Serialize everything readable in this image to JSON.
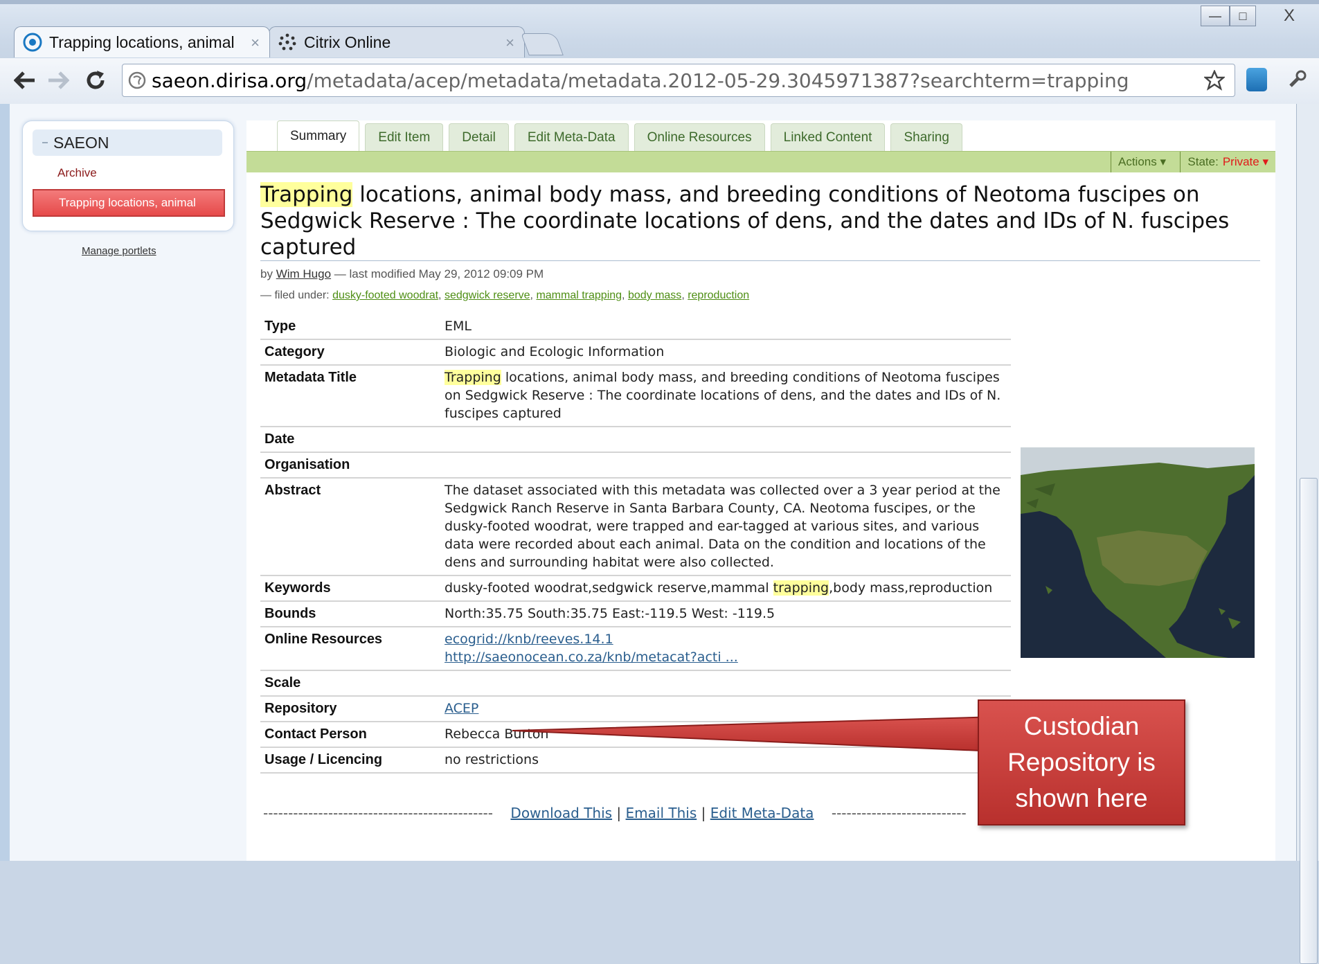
{
  "browser": {
    "tabs": [
      {
        "label": "Trapping locations, animal",
        "active": true,
        "icon": "globe-icon"
      },
      {
        "label": "Citrix Online",
        "active": false,
        "icon": "citrix-icon"
      }
    ],
    "address": {
      "host": "saeon.dirisa.org",
      "path": "/metadata/acep/metadata/metadata.2012-05-29.3045971387?searchterm=trapping"
    },
    "window_buttons": {
      "minimize": "—",
      "maximize": "□",
      "close": "X"
    }
  },
  "portlet": {
    "header": "SAEON",
    "archive_link": "Archive",
    "selected_item": "Trapping locations, animal",
    "manage_link": "Manage portlets"
  },
  "content_tabs": [
    "Summary",
    "Edit Item",
    "Detail",
    "Edit Meta-Data",
    "Online Resources",
    "Linked Content",
    "Sharing"
  ],
  "action_bar": {
    "actions": "Actions ▾",
    "state_label": "State:",
    "state_value": "Private ▾"
  },
  "title": {
    "highlight": "Trapping",
    "rest": " locations, animal body mass, and breeding conditions of Neotoma fuscipes on Sedgwick Reserve : The coordinate locations of dens, and the dates and IDs of N. fuscipes captured"
  },
  "byline": {
    "prefix": "by",
    "author": "Wim Hugo",
    "modified": "— last modified May 29, 2012 09:09 PM"
  },
  "filed": {
    "prefix": "— filed under:",
    "tags": [
      "dusky-footed woodrat",
      "sedgwick reserve",
      "mammal trapping",
      "body mass",
      "reproduction"
    ]
  },
  "metadata": {
    "type": {
      "label": "Type",
      "value": "EML"
    },
    "category": {
      "label": "Category",
      "value": "Biologic and Ecologic Information"
    },
    "metadata_title": {
      "label": "Metadata Title",
      "highlight": "Trapping",
      "rest": " locations, animal body mass, and breeding conditions of Neotoma fuscipes on Sedgwick Reserve : The coordinate locations of dens, and the dates and IDs of N. fuscipes captured"
    },
    "date": {
      "label": "Date",
      "value": ""
    },
    "organisation": {
      "label": "Organisation",
      "value": ""
    },
    "abstract": {
      "label": "Abstract",
      "value": "The dataset associated with this metadata was collected over a 3 year period at the Sedgwick Ranch Reserve in Santa Barbara County, CA. Neotoma fuscipes, or the dusky-footed woodrat, were trapped and ear-tagged at various sites, and various data were recorded about each animal. Data on the condition and locations of the dens and surrounding habitat were also collected."
    },
    "keywords": {
      "label": "Keywords",
      "before": "dusky-footed woodrat,sedgwick reserve,mammal ",
      "highlight": "trapping",
      "after": ",body mass,reproduction"
    },
    "bounds": {
      "label": "Bounds",
      "value": "North:35.75 South:35.75 East:-119.5 West: -119.5"
    },
    "online_resources": {
      "label": "Online Resources",
      "link1": "ecogrid://knb/reeves.14.1",
      "link2": "http://saeonocean.co.za/knb/metacat?acti ..."
    },
    "scale": {
      "label": "Scale",
      "value": ""
    },
    "repository": {
      "label": "Repository",
      "value": "ACEP"
    },
    "contact": {
      "label": "Contact Person",
      "value": "Rebecca Burton"
    },
    "usage": {
      "label": "Usage / Licencing",
      "value": "no restrictions"
    }
  },
  "footer": {
    "dashes_left": "----------------------------------------------",
    "download": "Download This",
    "email": "Email This",
    "edit": "Edit Meta-Data",
    "sep": "|",
    "dashes_right": "---------------------------"
  },
  "callout": {
    "text": "Custodian\nRepository is\nshown here"
  },
  "colors": {
    "accent_green": "#c3dc97",
    "selected_red": "#e64a4a",
    "callout_red": "#c43c38",
    "highlight": "#ffff9c"
  }
}
